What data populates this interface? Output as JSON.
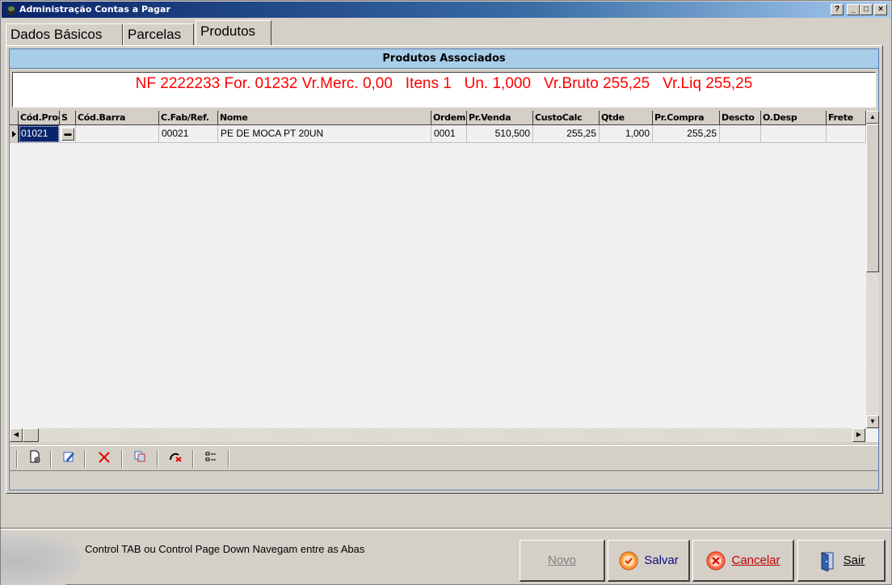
{
  "window": {
    "title": "Administração Contas a Pagar",
    "controls": [
      "?",
      "_",
      "□",
      "×"
    ]
  },
  "tabs": [
    {
      "label": "Dados Básicos",
      "active": false
    },
    {
      "label": "Parcelas",
      "active": false
    },
    {
      "label": "Produtos",
      "active": true
    }
  ],
  "panel": {
    "header": "Produtos Associados",
    "summary": "NF 2222233 For. 01232 Vr.Merc. 0,00   Itens 1   Un. 1,000   Vr.Bruto 255,25   Vr.Liq 255,25",
    "summary_color": "#ff0000"
  },
  "grid": {
    "columns": [
      "Cód.Prod",
      "S",
      "Cód.Barra",
      "C.Fab/Ref.",
      "Nome",
      "Ordem",
      "Pr.Venda",
      "CustoCalc",
      "Qtde",
      "Pr.Compra",
      "Descto",
      "O.Desp",
      "Frete"
    ],
    "rows": [
      {
        "cod_prod": "01021",
        "s": "...",
        "cod_barra": "",
        "c_fab_ref": "00021",
        "nome": "PE DE MOCA PT 20UN",
        "ordem": "0001",
        "pr_venda": "510,500",
        "custo_calc": "255,25",
        "qtde": "1,000",
        "pr_compra": "255,25",
        "descto": "",
        "o_desp": "",
        "frete": ""
      }
    ]
  },
  "toolbar": {
    "icons": [
      "new-document-icon",
      "edit-icon",
      "delete-icon",
      "copy-icon",
      "cancel-icon",
      "list-icon"
    ]
  },
  "footer": {
    "hint": "Control TAB ou Control Page Down Navegam entre as Abas",
    "buttons": {
      "novo": "Novo",
      "salvar": "Salvar",
      "cancelar": "Cancelar",
      "sair": "Sair"
    }
  }
}
